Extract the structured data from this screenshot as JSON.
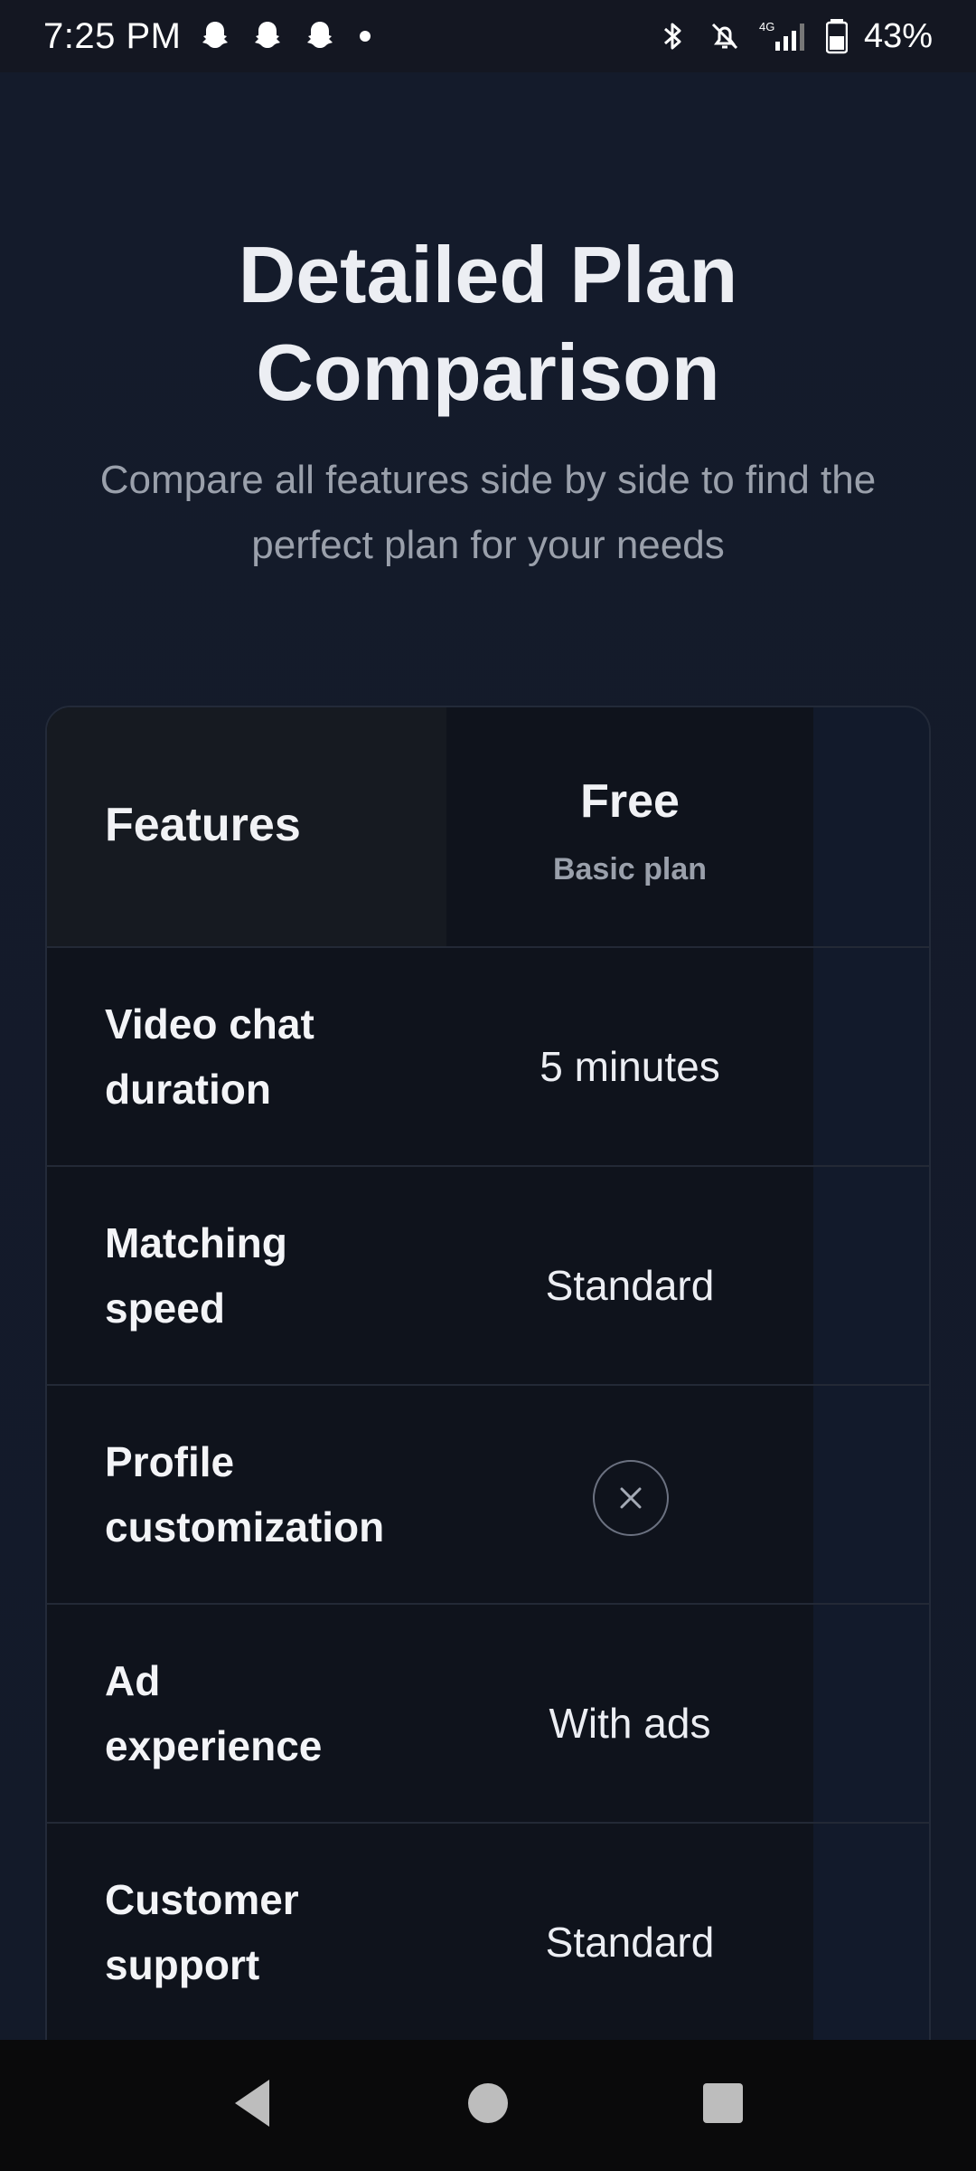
{
  "status_bar": {
    "time": "7:25 PM",
    "notification_icons": [
      "snapchat-icon",
      "snapchat-icon",
      "snapchat-icon"
    ],
    "network_label": "4G",
    "battery_percent": "43%"
  },
  "header": {
    "title_line1": "Detailed Plan",
    "title_line2": "Comparison",
    "subtitle_line1": "Compare all features side by side to find the",
    "subtitle_line2": "perfect plan for your needs"
  },
  "table": {
    "features_header": "Features",
    "plan": {
      "name": "Free",
      "subtitle": "Basic plan"
    },
    "rows": [
      {
        "label_line1": "Video chat",
        "label_line2": "duration",
        "value": "5 minutes"
      },
      {
        "label_line1": "Matching",
        "label_line2": "speed",
        "value": "Standard"
      },
      {
        "label_line1": "Profile",
        "label_line2": "customization",
        "value_icon": "x-circle-icon"
      },
      {
        "label_line1": "Ad",
        "label_line2": "experience",
        "value": "With ads"
      },
      {
        "label_line1": "Customer",
        "label_line2": "support",
        "value": "Standard"
      }
    ]
  },
  "nav_bar": {
    "buttons": [
      "back-icon",
      "home-icon",
      "recents-icon"
    ]
  }
}
